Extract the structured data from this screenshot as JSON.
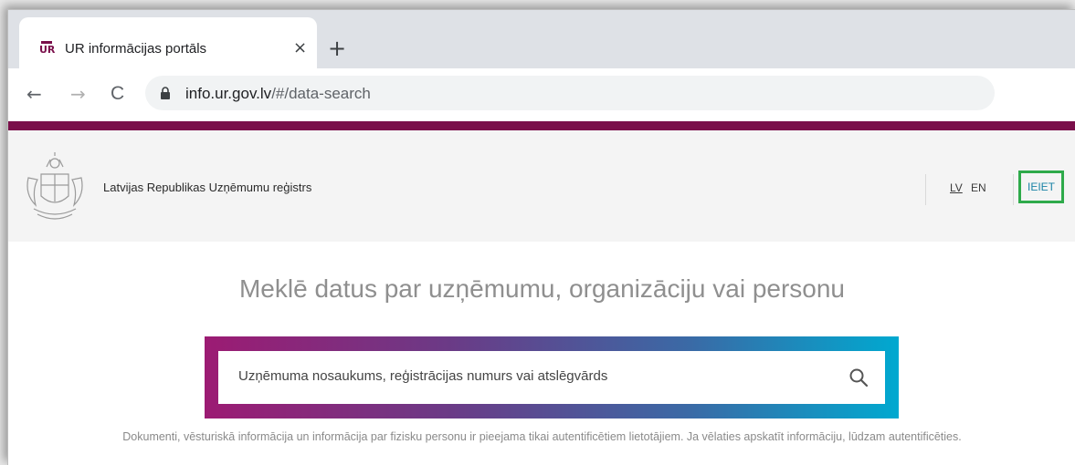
{
  "browser": {
    "tab_title": "UR informācijas portāls",
    "tab_favicon_text": "UR",
    "close_symbol": "×",
    "new_tab_symbol": "+",
    "back_symbol": "←",
    "forward_symbol": "→",
    "reload_symbol": "C",
    "url_host": "info.ur.gov.lv",
    "url_path": "/#/data-search"
  },
  "header": {
    "site_name": "Latvijas Republikas Uzņēmumu reģistrs",
    "lang_lv": "LV",
    "lang_en": "EN",
    "login_label": "IEIET"
  },
  "main": {
    "headline": "Meklē datus par uzņēmumu, organizāciju vai personu",
    "search_placeholder": "Uzņēmuma nosaukums, reģistrācijas numurs vai atslēgvārds",
    "notice": "Dokumenti, vēsturiskā informācija un informācija par fizisku personu ir pieejama tikai autentificētiem lietotājiem. Ja vēlaties apskatīt informāciju, lūdzam autentificēties."
  },
  "colors": {
    "brand": "#7a0f4a",
    "login_highlight": "#2eaa4a",
    "login_text": "#1a83a6",
    "gradient_start": "#9c1b73",
    "gradient_end": "#00a9d0"
  },
  "icons": [
    "ur-favicon-icon",
    "close-icon",
    "plus-icon",
    "back-arrow-icon",
    "forward-arrow-icon",
    "reload-icon",
    "lock-icon",
    "coat-of-arms-icon",
    "search-icon"
  ]
}
